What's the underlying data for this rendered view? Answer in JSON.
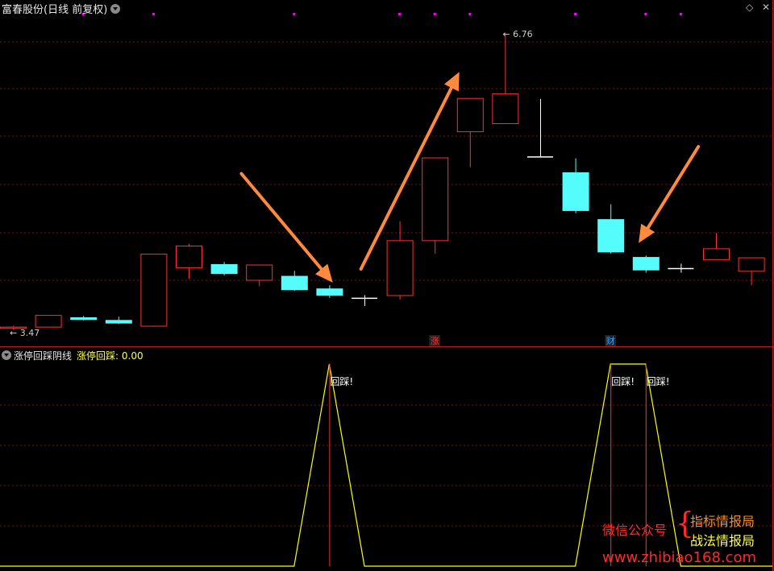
{
  "header": {
    "title": "富春股份(日线 前复权)",
    "sub_indicator": "涨停回踩阴线",
    "sub_value": "涨停回踩: 0.00"
  },
  "window_controls": [
    "◇",
    "✕"
  ],
  "watermark": {
    "left_text": "微信公众号",
    "right_line1": "指标情报局",
    "right_line2": "战法情报局",
    "url": "www.zhibiao168.com"
  },
  "colors": {
    "background": "#000000",
    "up": "#ff3030",
    "down": "#54fcfc",
    "flat": "#ffffff",
    "line": "#ffff00",
    "arrow": "#ff8a3d",
    "grid": "#7a1010",
    "magenta_dot": "#ff00ff"
  },
  "chart_data": [
    {
      "type": "candlestick",
      "ylim": [
        3.3,
        6.95
      ],
      "max_label": "6.76",
      "min_label": "3.47",
      "candles": [
        {
          "o": 3.49,
          "h": 3.51,
          "l": 3.47,
          "c": 3.5
        },
        {
          "o": 3.5,
          "h": 3.63,
          "l": 3.5,
          "c": 3.63
        },
        {
          "o": 3.6,
          "h": 3.62,
          "l": 3.57,
          "c": 3.58
        },
        {
          "o": 3.57,
          "h": 3.61,
          "l": 3.53,
          "c": 3.54
        },
        {
          "o": 3.51,
          "h": 4.31,
          "l": 3.5,
          "c": 4.31
        },
        {
          "o": 4.16,
          "h": 4.42,
          "l": 4.03,
          "c": 4.4
        },
        {
          "o": 4.19,
          "h": 4.22,
          "l": 4.07,
          "c": 4.09
        },
        {
          "o": 4.02,
          "h": 4.18,
          "l": 3.95,
          "c": 4.19
        },
        {
          "o": 4.06,
          "h": 4.12,
          "l": 3.9,
          "c": 3.91
        },
        {
          "o": 3.92,
          "h": 3.96,
          "l": 3.82,
          "c": 3.85
        },
        {
          "o": 3.82,
          "h": 3.85,
          "l": 3.73,
          "c": 3.82
        },
        {
          "o": 3.85,
          "h": 4.67,
          "l": 3.8,
          "c": 4.46
        },
        {
          "o": 4.46,
          "h": 5.38,
          "l": 4.31,
          "c": 5.38
        },
        {
          "o": 5.67,
          "h": 6.04,
          "l": 5.27,
          "c": 6.04
        },
        {
          "o": 5.76,
          "h": 6.76,
          "l": 5.76,
          "c": 6.09
        },
        {
          "o": 5.39,
          "h": 6.03,
          "l": 5.39,
          "c": 5.39
        },
        {
          "o": 5.21,
          "h": 5.37,
          "l": 4.76,
          "c": 4.79
        },
        {
          "o": 4.69,
          "h": 4.86,
          "l": 4.31,
          "c": 4.33
        },
        {
          "o": 4.27,
          "h": 4.29,
          "l": 4.1,
          "c": 4.13
        },
        {
          "o": 4.15,
          "h": 4.2,
          "l": 4.1,
          "c": 4.15
        },
        {
          "o": 4.25,
          "h": 4.54,
          "l": 4.25,
          "c": 4.37
        },
        {
          "o": 4.12,
          "h": 4.27,
          "l": 3.96,
          "c": 4.27
        }
      ],
      "markers": [
        {
          "index": 12,
          "label": "涨",
          "color": "#ff3030"
        },
        {
          "index": 17,
          "label": "财",
          "color": "#3aa0ff"
        }
      ]
    },
    {
      "type": "line",
      "name": "涨停回踩",
      "ylim": [
        0,
        1
      ],
      "values": [
        0,
        0,
        0,
        0,
        0,
        0,
        0,
        0,
        0,
        1,
        0,
        0,
        0,
        0,
        0,
        0,
        0,
        1,
        1,
        0,
        0,
        0
      ],
      "signal_indices": [
        9,
        17,
        18
      ],
      "signal_label": "回踩!"
    }
  ]
}
